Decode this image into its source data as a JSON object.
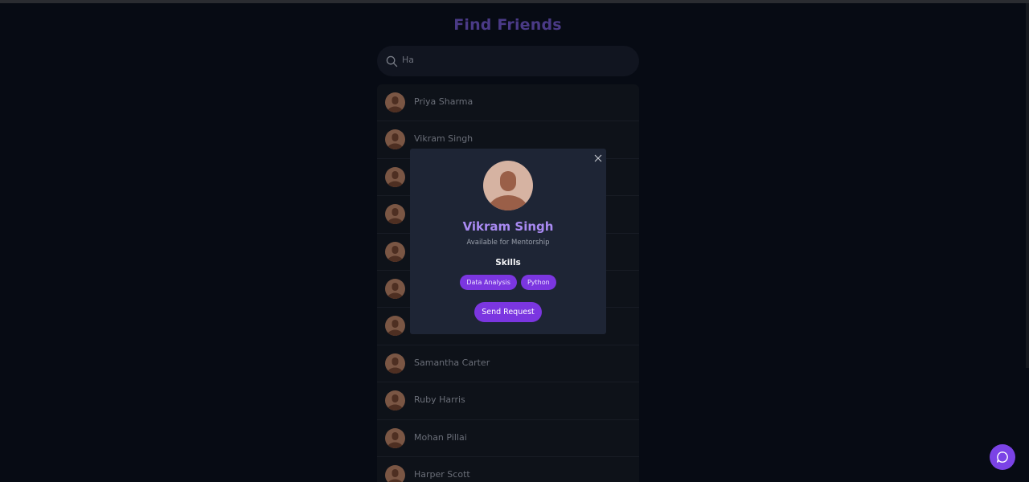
{
  "page": {
    "title": "Find Friends"
  },
  "search": {
    "value": "Ha",
    "icon": "search-icon"
  },
  "friends": [
    {
      "name": "Priya Sharma"
    },
    {
      "name": "Vikram Singh"
    },
    {
      "name": ""
    },
    {
      "name": ""
    },
    {
      "name": ""
    },
    {
      "name": ""
    },
    {
      "name": ""
    },
    {
      "name": "Samantha Carter"
    },
    {
      "name": "Ruby Harris"
    },
    {
      "name": "Mohan Pillai"
    },
    {
      "name": "Harper Scott"
    }
  ],
  "modal": {
    "name": "Vikram Singh",
    "status": "Available for Mentorship",
    "skills_label": "Skills",
    "skills": [
      "Data Analysis",
      "Python"
    ],
    "send_label": "Send Request",
    "close_icon": "close-icon"
  },
  "chat": {
    "icon": "chat-bubble-icon"
  },
  "colors": {
    "accent": "#7b36e0",
    "title": "#4a3a86",
    "modal_name": "#a98af2",
    "background": "#070b14"
  }
}
